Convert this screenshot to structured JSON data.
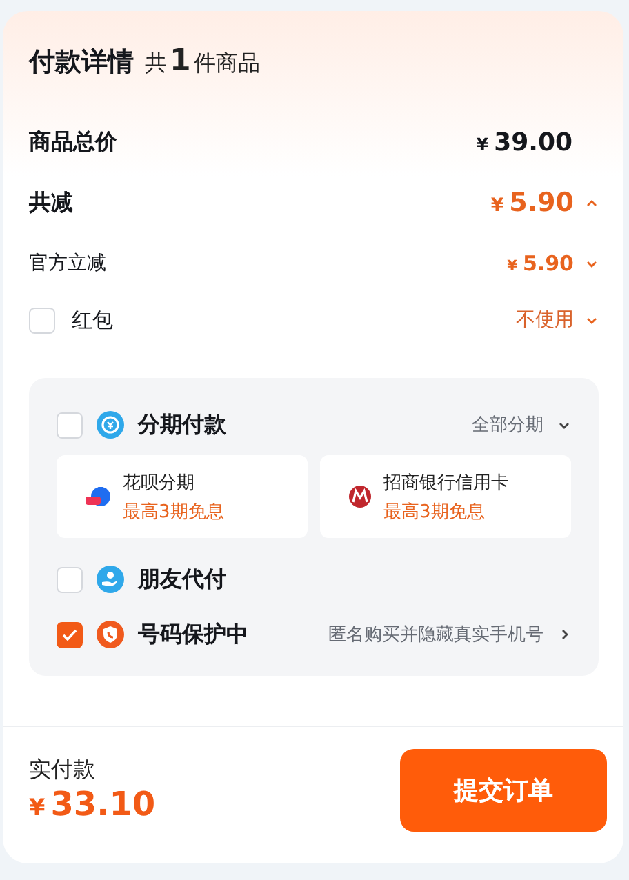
{
  "header": {
    "title": "付款详情",
    "count_prefix": "共",
    "count": "1",
    "count_suffix": "件商品"
  },
  "summary": [
    {
      "kind": "total",
      "label": "商品总价",
      "currency": "¥",
      "amount": "39.00"
    },
    {
      "kind": "discount",
      "label": "共减",
      "currency": "¥",
      "amount": "5.90",
      "expanded": true
    },
    {
      "kind": "sub",
      "label": "官方立减",
      "currency": "¥",
      "amount": "5.90",
      "expanded": false
    },
    {
      "kind": "check",
      "label": "红包",
      "checked": false,
      "value": "不使用",
      "expanded": false
    }
  ],
  "options": [
    {
      "kind": "installment",
      "label": "分期付款",
      "checked": false,
      "link": "全部分期",
      "plans": [
        {
          "name": "花呗分期",
          "promo": "最高3期免息"
        },
        {
          "name": "招商银行信用卡",
          "promo": "最高3期免息"
        }
      ]
    },
    {
      "kind": "plain",
      "label": "朋友代付",
      "checked": false
    },
    {
      "kind": "link",
      "label": "号码保护中",
      "checked": true,
      "link": "匿名购买并隐藏真实手机号"
    }
  ],
  "footer": {
    "label": "实付款",
    "currency": "¥",
    "amount": "33.10",
    "button": "提交订单"
  }
}
